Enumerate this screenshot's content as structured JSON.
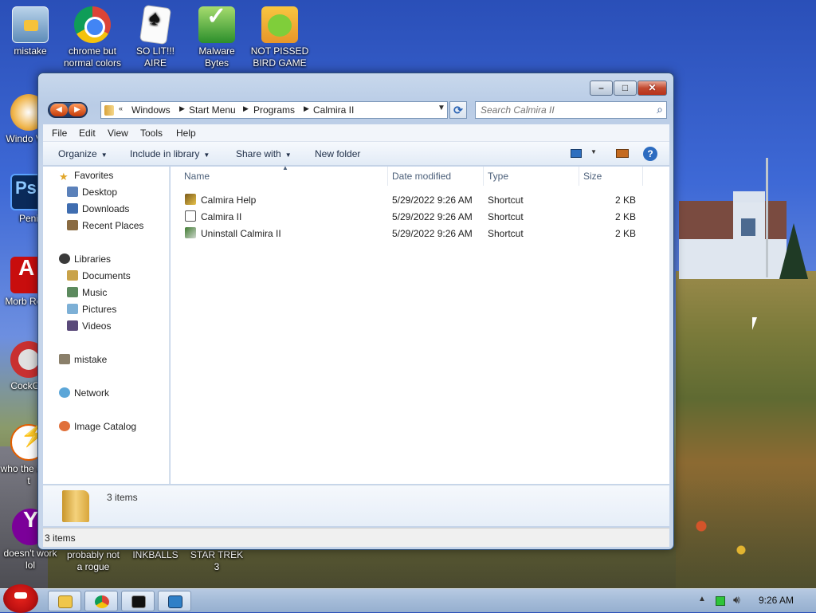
{
  "desktop_icons": [
    {
      "label": "mistake",
      "icon": "computer-icon"
    },
    {
      "label": "chrome but normal colors",
      "icon": "chrome-icon"
    },
    {
      "label": "SO LIT!!! AIRE",
      "icon": "solitaire-icon"
    },
    {
      "label": "Malware Bytes",
      "icon": "shield-icon"
    },
    {
      "label": "NOT PISSED BIRD GAME",
      "icon": "pig-icon"
    },
    {
      "label": "Windo Vist",
      "icon": "windows-icon"
    },
    {
      "label": "Peni",
      "icon": "photoshop-icon"
    },
    {
      "label": "Morb Read",
      "icon": "pdf-icon"
    },
    {
      "label": "CockCle",
      "icon": "ccleaner-icon"
    },
    {
      "label": "who the uses t",
      "icon": "lightning-icon"
    },
    {
      "label": "doesn't work lol",
      "icon": "yahoo-icon"
    },
    {
      "label": "probably not a rogue",
      "icon": ""
    },
    {
      "label": "INKBALLS",
      "icon": ""
    },
    {
      "label": "STAR TREK 3",
      "icon": ""
    }
  ],
  "window": {
    "address": [
      "Windows",
      "Start Menu",
      "Programs",
      "Calmira II"
    ],
    "search_placeholder": "Search Calmira II",
    "menu": [
      "File",
      "Edit",
      "View",
      "Tools",
      "Help"
    ],
    "commands": {
      "organize": "Organize",
      "include_library": "Include in library",
      "share_with": "Share with",
      "new_folder": "New folder"
    },
    "nav": {
      "favorites": "Favorites",
      "favorites_items": [
        "Desktop",
        "Downloads",
        "Recent Places"
      ],
      "libraries": "Libraries",
      "libraries_items": [
        "Documents",
        "Music",
        "Pictures",
        "Videos"
      ],
      "user": "mistake",
      "network": "Network",
      "image_catalog": "Image Catalog"
    },
    "columns": [
      "Name",
      "Date modified",
      "Type",
      "Size"
    ],
    "files": [
      {
        "name": "Calmira Help",
        "date": "5/29/2022 9:26 AM",
        "type": "Shortcut",
        "size": "2 KB"
      },
      {
        "name": "Calmira II",
        "date": "5/29/2022 9:26 AM",
        "type": "Shortcut",
        "size": "2 KB"
      },
      {
        "name": "Uninstall Calmira II",
        "date": "5/29/2022 9:26 AM",
        "type": "Shortcut",
        "size": "2 KB"
      }
    ],
    "details_count": "3 items",
    "status": "3 items"
  },
  "taskbar": {
    "time": "9:26 AM"
  }
}
